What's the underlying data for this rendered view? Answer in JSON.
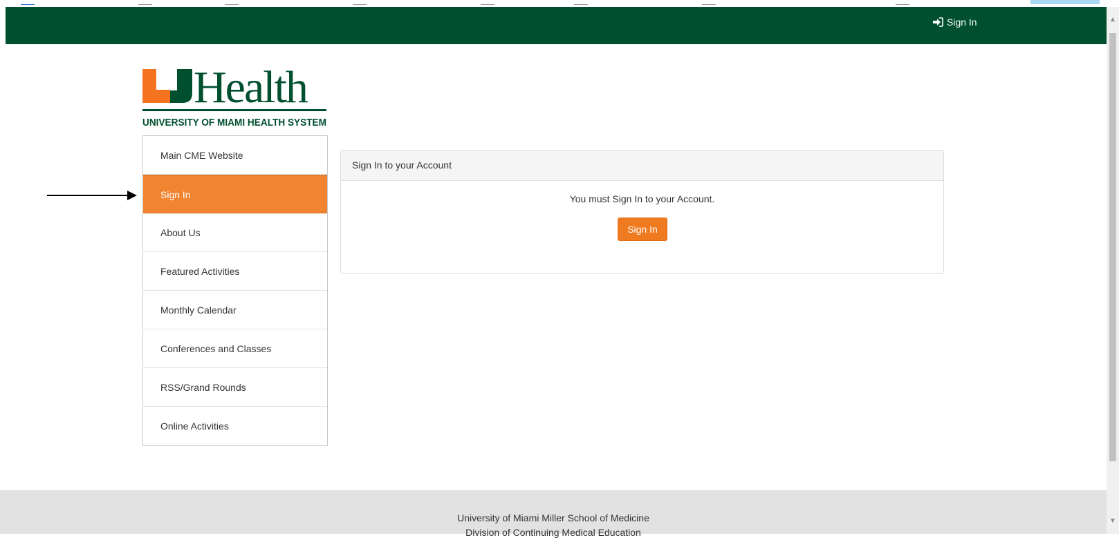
{
  "navbar": {
    "signin_label": "Sign In",
    "background": "#005030",
    "icon": "sign-in-icon"
  },
  "logo": {
    "brand": "UHealth",
    "tagline": "UNIVERSITY OF MIAMI HEALTH SYSTEM",
    "orange": "#f47321",
    "green": "#005030"
  },
  "sidebar": {
    "items": [
      {
        "label": "Main CME Website",
        "active": false
      },
      {
        "label": "Sign In",
        "active": true
      },
      {
        "label": "About Us",
        "active": false
      },
      {
        "label": "Featured Activities",
        "active": false
      },
      {
        "label": "Monthly Calendar",
        "active": false
      },
      {
        "label": "Conferences and Classes",
        "active": false
      },
      {
        "label": "RSS/Grand Rounds",
        "active": false
      },
      {
        "label": "Online Activities",
        "active": false
      }
    ],
    "active_color": "#f08430"
  },
  "panel": {
    "title": "Sign In to your Account",
    "message": "You must Sign In to your Account.",
    "button_label": "Sign In",
    "button_color": "#f07a20"
  },
  "footer": {
    "line1": "University of Miami Miller School of Medicine",
    "line2": "Division of Continuing Medical Education"
  }
}
